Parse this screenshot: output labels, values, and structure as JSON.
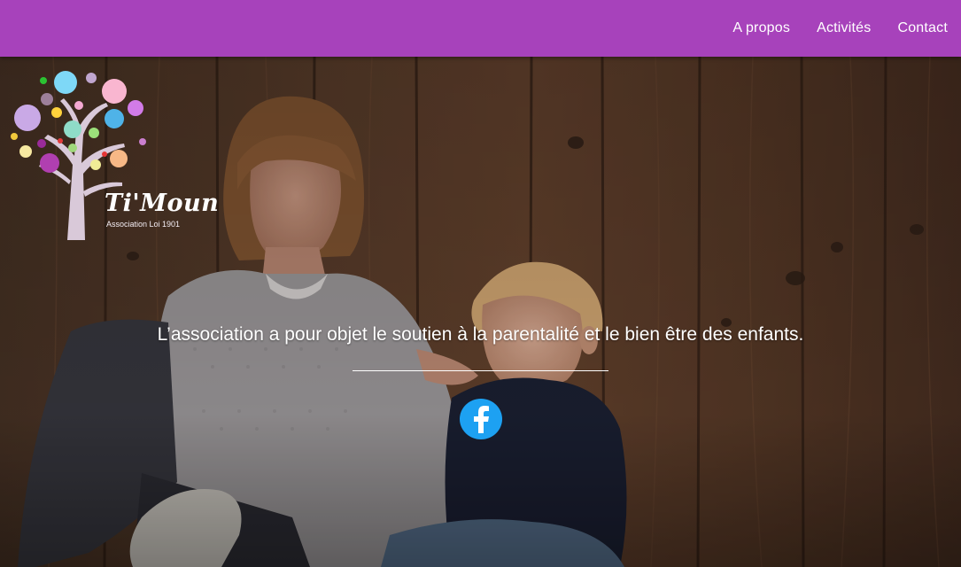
{
  "navbar": {
    "links": [
      {
        "label": "A propos"
      },
      {
        "label": "Activités"
      },
      {
        "label": "Contact"
      }
    ]
  },
  "logo": {
    "name": "Ti'Moun",
    "subtitle": "Association Loi 1901"
  },
  "hero": {
    "tagline": "L’association a pour objet le soutien à la parentalité et le bien être des enfants."
  },
  "social": {
    "facebook_icon": "facebook-icon"
  },
  "colors": {
    "navbar": "#a742bb",
    "facebook": "#1da1f2"
  }
}
